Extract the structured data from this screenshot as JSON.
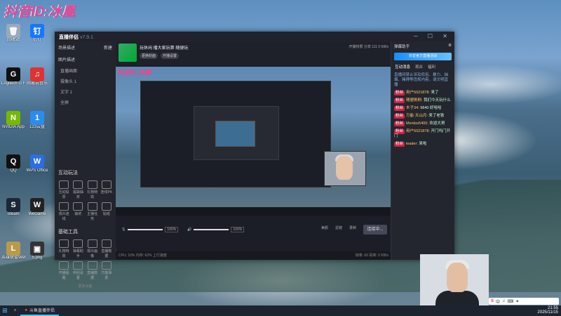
{
  "desktop": {
    "overlay_logo": "抖音ID:冰凰",
    "icons": [
      {
        "label": "回收站",
        "color": "#9ab",
        "glyph": "🗑"
      },
      {
        "label": "钉钉",
        "color": "#1677ff",
        "glyph": "钉"
      },
      {
        "label": "Logitech G HUB",
        "color": "#111",
        "glyph": "G"
      },
      {
        "label": "网易云音乐",
        "color": "#d33",
        "glyph": "♫"
      },
      {
        "label": "NVIDIA App",
        "color": "#76b900",
        "glyph": "N"
      },
      {
        "label": "123云盘",
        "color": "#2b8cf0",
        "glyph": "1"
      },
      {
        "label": "QQ",
        "color": "#111",
        "glyph": "Q"
      },
      {
        "label": "WPS Office",
        "color": "#2a6ee0",
        "glyph": "W"
      },
      {
        "label": "Steam",
        "color": "#1b2838",
        "glyph": "S"
      },
      {
        "label": "WeGame",
        "color": "#222",
        "glyph": "W"
      },
      {
        "label": "英雄联盟WeGame版",
        "color": "#b89b4a",
        "glyph": "L"
      },
      {
        "label": "5.png",
        "color": "#333",
        "glyph": "▣"
      }
    ]
  },
  "app": {
    "title": "直播伴侣",
    "version": "v7.9.1",
    "header": {
      "room_title": "玩休闲 播大家玩第 随便玩",
      "tags": [
        "更换封面",
        "开播设置"
      ],
      "right_items": [
        "开播权限",
        "分享",
        "111",
        "0 KB/s"
      ]
    },
    "sidebar": {
      "scene_label": "场景描述",
      "scene_action": "新建",
      "source_header": "图片描述",
      "items": [
        "直播画面",
        "摄像头 1",
        "文字 1",
        "全屏"
      ],
      "interaction_title": "互动玩法",
      "interaction_tools": [
        "互动投票",
        "福袋抽奖",
        "礼物特效",
        "连线PK",
        "观众连线",
        "抽奖",
        "主播任务",
        "贴纸"
      ],
      "basic_title": "基础工具",
      "basic_tools": [
        "礼物特效",
        "弹幕助手",
        "观众画像",
        "直播数据",
        "开播提醒",
        "伴侣设置",
        "直播数据",
        "万能场景"
      ],
      "more": "更多功能"
    },
    "controls": {
      "mic_pct": "100%",
      "speaker_pct": "100%",
      "mic_level": 100,
      "speaker_level": 100,
      "icons": [
        "美颜",
        "滤镜",
        "录制"
      ],
      "start_button": "连接中..."
    },
    "status_bar": {
      "left": "CPU: 10%  内存: 62%  上行速度",
      "right": "帧率: 60  码率: 0 KB/s"
    },
    "chat": {
      "title": "弹幕助手",
      "banner": "抖音官方直播活动",
      "tabs": [
        "互动消息",
        "观众",
        "福利"
      ],
      "notice": "直播间禁止涉及低俗、暴力、抽烟、赌博等违规内容，请文明直播",
      "messages": [
        {
          "badge": "粉丝",
          "name": "用户5021878",
          "text": "来了"
        },
        {
          "badge": "粉丝",
          "name": "随便刷刷",
          "text": "我们今天玩什么"
        },
        {
          "badge": "粉丝",
          "name": "木子34",
          "text": "9840 好哈哈"
        },
        {
          "badge": "粉丝",
          "name": "万能·天山月",
          "text": "来了老铁"
        },
        {
          "badge": "粉丝",
          "name": "Mentos5400",
          "text": "欢迎大哥"
        },
        {
          "badge": "粉丝",
          "name": "用户5021878",
          "text": "开门吗门开门"
        },
        {
          "badge": "粉丝",
          "name": "leader",
          "text": "来啦"
        }
      ]
    }
  },
  "taskbar": {
    "search_icon": "search-icon",
    "active_app": "斗鱼直播伴侣",
    "time": "21:55",
    "date": "2025/11/15"
  },
  "ime": {
    "label": "中",
    "items": [
      "♫",
      "⌨",
      "✦"
    ]
  }
}
